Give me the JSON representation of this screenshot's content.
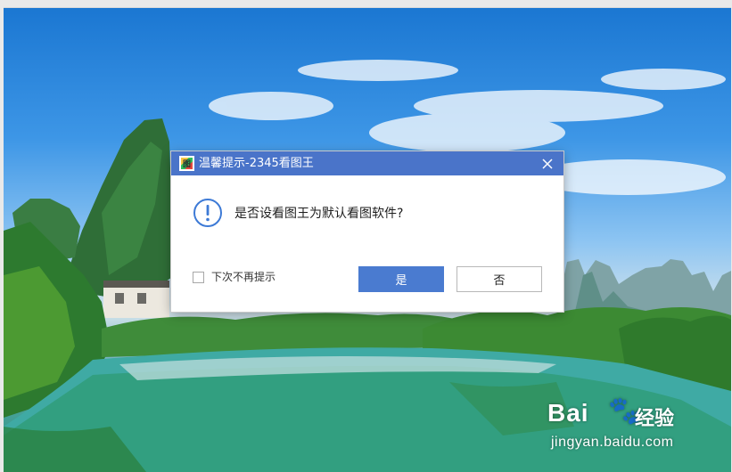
{
  "dialog": {
    "title": "温馨提示-2345看图王",
    "app_icon_glyph": "图",
    "message": "是否设看图王为默认看图软件?",
    "checkbox_label": "下次不再提示",
    "checkbox_checked": false,
    "yes_label": "是",
    "no_label": "否",
    "icons": {
      "app": "2345-picture-viewer-icon",
      "close": "close-icon",
      "info": "exclamation-circle-icon"
    },
    "colors": {
      "titlebar": "#4a74c9",
      "primary_button": "#4a7bd0",
      "info_icon": "#3d7ad6"
    }
  },
  "watermark": {
    "brand": "Bai",
    "brand_suffix": "经验",
    "url": "jingyan.baidu.com"
  }
}
